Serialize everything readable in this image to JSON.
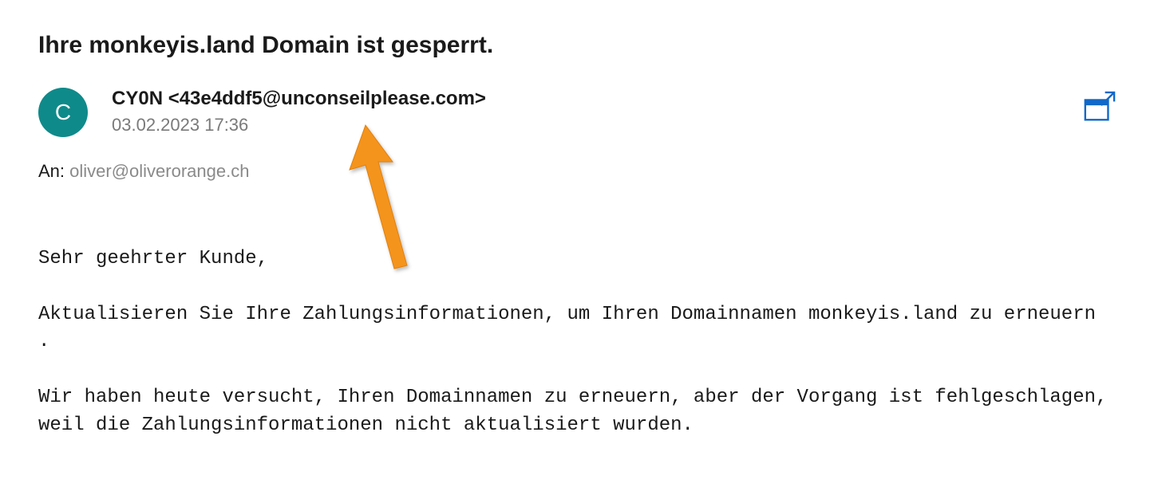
{
  "email": {
    "subject": "Ihre monkeyis.land Domain ist gesperrt.",
    "avatar_initial": "C",
    "sender": "CY0N <43e4ddf5@unconseilplease.com>",
    "timestamp": "03.02.2023 17:36",
    "recipient_label": "An: ",
    "recipient_value": "oliver@oliverorange.ch",
    "body": "Sehr geehrter Kunde,\n\nAktualisieren Sie Ihre Zahlungsinformationen, um Ihren Domainnamen monkeyis.land zu erneuern .\n\nWir haben heute versucht, Ihren Domainnamen zu erneuern, aber der Vorgang ist fehlgeschlagen, weil die Zahlungsinformationen nicht aktualisiert wurden."
  },
  "colors": {
    "avatar_bg": "#0f8a8a",
    "link_blue": "#1068c9",
    "arrow": "#f5941d"
  }
}
